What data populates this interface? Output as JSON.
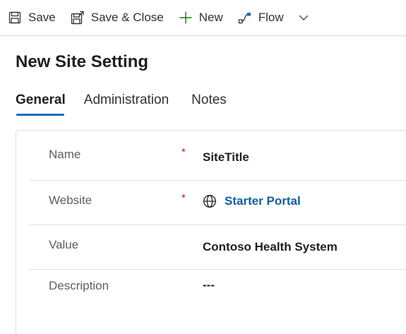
{
  "toolbar": {
    "save_label": "Save",
    "save_close_label": "Save & Close",
    "new_label": "New",
    "flow_label": "Flow",
    "icons": {
      "save": "save-icon",
      "save_close": "save-close-icon",
      "new": "plus-icon",
      "flow": "flow-icon",
      "more": "chevron-down-icon"
    }
  },
  "page": {
    "title": "New Site Setting"
  },
  "tabs": [
    {
      "label": "General",
      "active": true
    },
    {
      "label": "Administration",
      "active": false
    },
    {
      "label": "Notes",
      "active": false
    }
  ],
  "form": {
    "fields": [
      {
        "label": "Name",
        "required": "*",
        "value": "SiteTitle"
      },
      {
        "label": "Website",
        "required": "*",
        "value": "Starter Portal",
        "icon": "globe-icon"
      },
      {
        "label": "Value",
        "value": "Contoso Health System"
      },
      {
        "label": "Description",
        "value": "---"
      }
    ]
  },
  "colors": {
    "accent": "#0f6cbd",
    "link": "#115ea3",
    "required": "#a4262c",
    "new_icon": "#107c10"
  }
}
